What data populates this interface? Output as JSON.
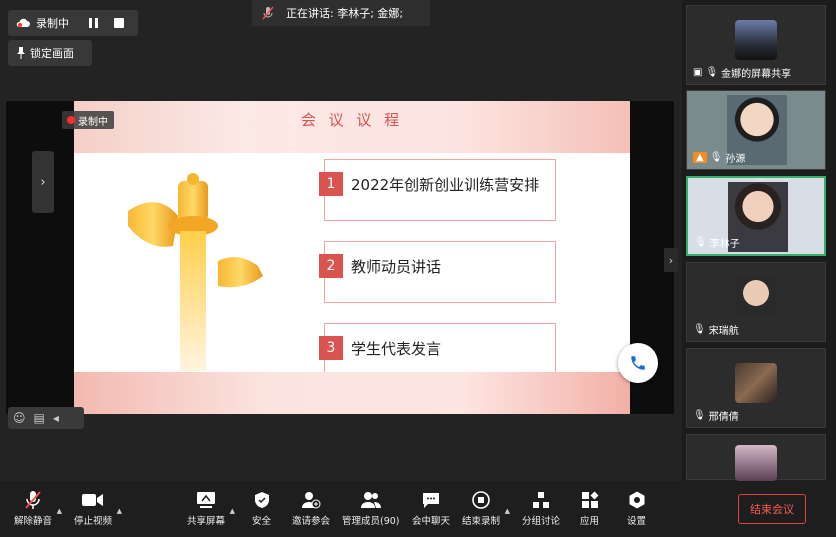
{
  "top_bar": {
    "recording_label": "录制中",
    "lock_label": "锁定画面",
    "speaking_text": "正在讲话: 李林子; 金娜;"
  },
  "stage": {
    "recording_badge": "录制中",
    "slide": {
      "title": "会 议 议 程",
      "items": [
        {
          "num": "1",
          "label": "2022年创新创业训练营安排"
        },
        {
          "num": "2",
          "label": "教师动员讲话"
        },
        {
          "num": "3",
          "label": "学生代表发言"
        }
      ]
    }
  },
  "participants": [
    {
      "name": "金娜的屏幕共享",
      "icon": "screen-share-icon"
    },
    {
      "name": "孙源",
      "icon": "mic-muted-icon"
    },
    {
      "name": "李林子",
      "icon": "mic-icon",
      "active": true
    },
    {
      "name": "宋瑞航",
      "icon": "mic-muted-icon"
    },
    {
      "name": "邢倩倩",
      "icon": "mic-muted-icon"
    }
  ],
  "toolbar": {
    "unmute": "解除静音",
    "stop_video": "停止视频",
    "share_screen": "共享屏幕",
    "security": "安全",
    "invite": "邀请参会",
    "manage_members": "管理成员(90)",
    "chat": "会中聊天",
    "end_recording": "结束录制",
    "breakout": "分组讨论",
    "apps": "应用",
    "settings": "设置",
    "end_meeting": "结束会议"
  },
  "colors": {
    "accent_red": "#d9534f",
    "active_border": "#2fb36a",
    "end_meeting": "#ff5a4f"
  }
}
